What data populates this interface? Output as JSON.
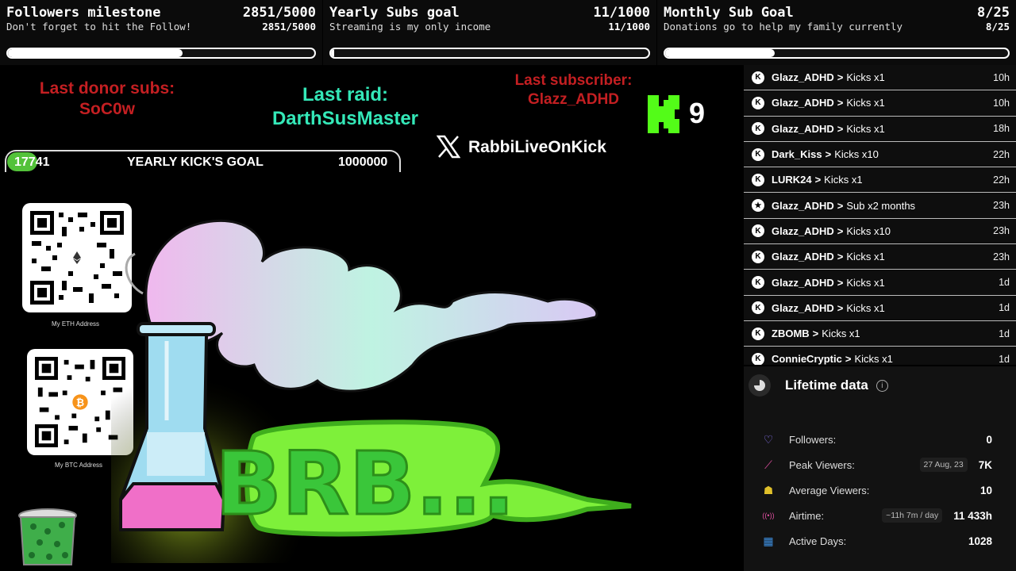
{
  "goals": [
    {
      "title": "Followers milestone",
      "count": "2851/5000",
      "subtitle": "Don't forget to hit the Follow!",
      "progress": 0.5702
    },
    {
      "title": "Yearly Subs goal",
      "count": "11/1000",
      "subtitle": "Streaming is my only income",
      "progress": 0.011
    },
    {
      "title": "Monthly Sub Goal",
      "count": "8/25",
      "subtitle": "Donations go to help my family currently",
      "progress": 0.32
    }
  ],
  "last_donor": {
    "label": "Last donor subs:",
    "name": "SoC0w"
  },
  "last_raid": {
    "label": "Last raid:",
    "name": "DarthSusMaster"
  },
  "last_subscriber": {
    "label": "Last subscriber:",
    "name": "Glazz_ADHD"
  },
  "kick_counter": "9",
  "kick_goal": {
    "current": "17741",
    "label": "YEARLY KICK'S GOAL",
    "target": "1000000",
    "progress": 0.017741
  },
  "social": {
    "handle": "RabbiLiveOnKick"
  },
  "qr": {
    "eth_caption": "My ETH Address",
    "btc_caption": "My BTC Address"
  },
  "overlay_text": "BRB...",
  "feed": [
    {
      "icon": "kick-icon",
      "user": "Glazz_ADHD",
      "action": "Kicks x1",
      "time": "10h"
    },
    {
      "icon": "kick-icon",
      "user": "Glazz_ADHD",
      "action": "Kicks x1",
      "time": "10h"
    },
    {
      "icon": "kick-icon",
      "user": "Glazz_ADHD",
      "action": "Kicks x1",
      "time": "18h"
    },
    {
      "icon": "kick-icon",
      "user": "Dark_Kiss",
      "action": "Kicks x10",
      "time": "22h"
    },
    {
      "icon": "kick-icon",
      "user": "LURK24",
      "action": "Kicks x1",
      "time": "22h"
    },
    {
      "icon": "star-icon",
      "user": "Glazz_ADHD",
      "action": "Sub x2 months",
      "time": "23h"
    },
    {
      "icon": "kick-icon",
      "user": "Glazz_ADHD",
      "action": "Kicks x10",
      "time": "23h"
    },
    {
      "icon": "kick-icon",
      "user": "Glazz_ADHD",
      "action": "Kicks x1",
      "time": "23h"
    },
    {
      "icon": "kick-icon",
      "user": "Glazz_ADHD",
      "action": "Kicks x1",
      "time": "1d"
    },
    {
      "icon": "kick-icon",
      "user": "Glazz_ADHD",
      "action": "Kicks x1",
      "time": "1d"
    },
    {
      "icon": "kick-icon",
      "user": "ZBOMB",
      "action": "Kicks x1",
      "time": "1d"
    },
    {
      "icon": "kick-icon",
      "user": "ConnieCryptic",
      "action": "Kicks x1",
      "time": "1d"
    }
  ],
  "lifetime": {
    "title": "Lifetime data",
    "stats": [
      {
        "icon": "heart-icon",
        "label": "Followers:",
        "chip": "",
        "value": "0"
      },
      {
        "icon": "chart-icon",
        "label": "Peak Viewers:",
        "chip": "27 Aug, 23",
        "value": "7K"
      },
      {
        "icon": "people-icon",
        "label": "Average Viewers:",
        "chip": "",
        "value": "10"
      },
      {
        "icon": "broadcast-icon",
        "label": "Airtime:",
        "chip": "~11h 7m / day",
        "value": "11 433h"
      },
      {
        "icon": "calendar-icon",
        "label": "Active Days:",
        "chip": "",
        "value": "1028"
      }
    ]
  },
  "colors": {
    "accent_green": "#53fc18",
    "red": "#c41f22",
    "teal": "#34e8b8",
    "feed_bg": "#0e0e0e"
  }
}
